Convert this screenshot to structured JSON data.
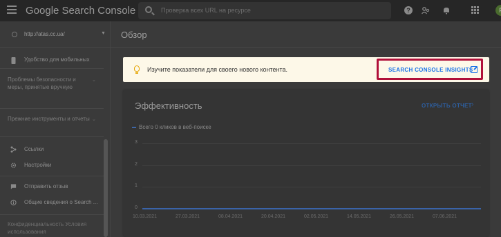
{
  "header": {
    "app_title": "Google Search Console",
    "search_placeholder": "Проверка всех URL на ресурсе",
    "help_glyph": "?",
    "avatar_letter": "F"
  },
  "sidebar": {
    "property": "http://atas.cc.ua/",
    "items": [
      {
        "label": "Удобство для мобильных",
        "icon": "mobile-icon"
      },
      {
        "label": "Проблемы безопасности и меры, принятые вручную",
        "type": "section"
      },
      {
        "label": "Прежние инструменты и отчеты",
        "type": "section"
      },
      {
        "label": "Ссылки",
        "icon": "links-icon"
      },
      {
        "label": "Настройки",
        "icon": "gear-icon"
      },
      {
        "label": "Отправить отзыв",
        "icon": "feedback-icon"
      },
      {
        "label": "Общие сведения о Search ...",
        "icon": "info-icon"
      }
    ],
    "footer": "Конфиденциальность   Условия использования"
  },
  "main": {
    "page_title": "Обзор",
    "banner": {
      "text": "Изучите показатели для своего нового контента.",
      "button_label": "SEARCH CONSOLE INSIGHTS"
    },
    "performance": {
      "title": "Эффективность",
      "open_report_label": "ОТКРЫТЬ ОТЧЕТ",
      "legend": "Всего 0 кликов в веб-поиске"
    }
  },
  "colors": {
    "highlight_border": "#b0103a",
    "link_blue": "#1a73e8",
    "banner_bg": "#fdf8e8"
  },
  "chart_data": {
    "type": "line",
    "title": "",
    "xlabel": "",
    "ylabel": "",
    "ylim": [
      0,
      3
    ],
    "y_ticks": [
      "3",
      "2",
      "1",
      "0"
    ],
    "categories": [
      "10.03.2021",
      "27.03.2021",
      "08.04.2021",
      "20.04.2021",
      "02.05.2021",
      "14.05.2021",
      "26.05.2021",
      "07.06.2021"
    ],
    "series": [
      {
        "name": "Всего 0 кликов в веб-поиске",
        "values": [
          0,
          0,
          0,
          0,
          0,
          0,
          0,
          0
        ]
      }
    ]
  }
}
